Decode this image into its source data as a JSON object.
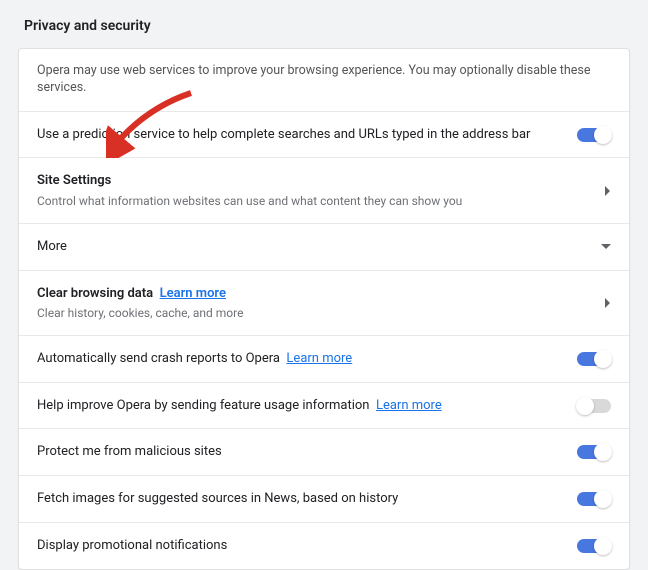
{
  "section_title": "Privacy and security",
  "rows": {
    "info": {
      "text": "Opera may use web services to improve your browsing experience. You may optionally disable these services."
    },
    "prediction": {
      "label": "Use a prediction service to help complete searches and URLs typed in the address bar",
      "toggle": true
    },
    "site_settings": {
      "title": "Site Settings",
      "sub": "Control what information websites can use and what content they can show you"
    },
    "more": {
      "label": "More"
    },
    "clear_data": {
      "title": "Clear browsing data",
      "link": "Learn more",
      "sub": "Clear history, cookies, cache, and more"
    },
    "crash_reports": {
      "label": "Automatically send crash reports to Opera",
      "link": "Learn more",
      "toggle": true
    },
    "feature_usage": {
      "label": "Help improve Opera by sending feature usage information",
      "link": "Learn more",
      "toggle": false
    },
    "malicious": {
      "label": "Protect me from malicious sites",
      "toggle": true
    },
    "news_images": {
      "label": "Fetch images for suggested sources in News, based on history",
      "toggle": true
    },
    "promo": {
      "label": "Display promotional notifications",
      "toggle": true
    }
  },
  "colors": {
    "accent": "#4877e0",
    "link": "#1a73e8",
    "arrow": "#d93025"
  }
}
